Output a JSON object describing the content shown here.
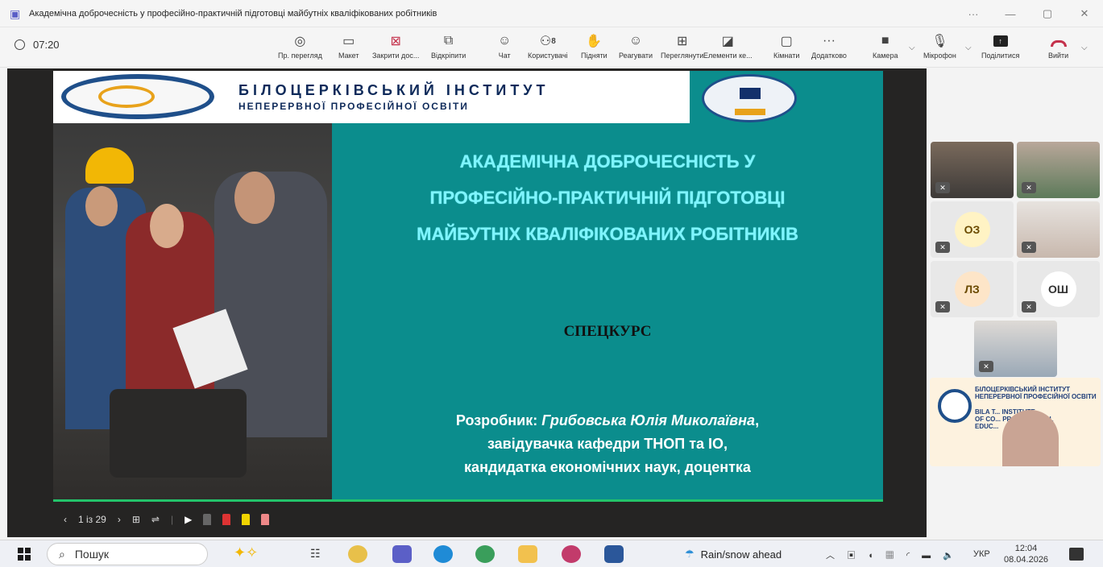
{
  "window": {
    "title": "Академічна доброчесність у професійно-практичній підготовці майбутніх кваліфікованих робітників",
    "controls": [
      "···",
      "—",
      "▢",
      "✕"
    ]
  },
  "meeting": {
    "elapsed": "07:20"
  },
  "toolbar": {
    "items": [
      {
        "label": "Пр. перегляд",
        "icon": "eye-icon"
      },
      {
        "label": "Макет",
        "icon": "layout-icon"
      },
      {
        "label": "Закрити дос...",
        "icon": "close-share-icon"
      },
      {
        "label": "Відкріпити",
        "icon": "unpin-icon"
      },
      {
        "label": "Чат",
        "icon": "chat-icon"
      },
      {
        "label": "Користувачі",
        "icon": "people-icon",
        "count": "8"
      },
      {
        "label": "Підняти",
        "icon": "raise-hand-icon"
      },
      {
        "label": "Реагувати",
        "icon": "react-icon"
      },
      {
        "label": "Переглянути",
        "icon": "view-icon"
      },
      {
        "label": "Елементи ке...",
        "icon": "apps-icon"
      },
      {
        "label": "Кімнати",
        "icon": "rooms-icon"
      },
      {
        "label": "Додатково",
        "icon": "more-icon"
      },
      {
        "label": "Камера",
        "icon": "camera-icon"
      },
      {
        "label": "Мікрофон",
        "icon": "mic-icon"
      },
      {
        "label": "Поділитися",
        "icon": "share-icon"
      },
      {
        "label": "Вийти",
        "icon": "leave-icon"
      }
    ]
  },
  "slide": {
    "institute_line1": "БІЛОЦЕРКІВСЬКИЙ ІНСТИТУТ",
    "institute_line2": "НЕПЕРЕРВНОЇ ПРОФЕСІЙНОЇ ОСВІТИ",
    "title_line1": "АКАДЕМІЧНА ДОБРОЧЕСНІСТЬ У",
    "title_line2": "ПРОФЕСІЙНО-ПРАКТИЧНІЙ ПІДГОТОВЦІ",
    "title_line3": "МАЙБУТНІХ КВАЛІФІКОВАНИХ РОБІТНИКІВ",
    "course": "СПЕЦКУРС",
    "author_prefix": "Розробник: ",
    "author_name": "Грибовська  Юлія Миколаївна",
    "author_suffix": ",",
    "author_line2": "завідувачка кафедри ТНОП та ІО,",
    "author_line3": "кандидатка економічних наук, доцентка"
  },
  "slide_controls": {
    "prev": "‹",
    "page": "1 із 29",
    "next": "›"
  },
  "participants": {
    "tiles": [
      {
        "initials": "",
        "kind": "video"
      },
      {
        "initials": "",
        "kind": "video"
      },
      {
        "initials": "ОЗ",
        "kind": "avatar"
      },
      {
        "initials": "",
        "kind": "video"
      },
      {
        "initials": "ЛЗ",
        "kind": "avatar"
      },
      {
        "initials": "ОШ",
        "kind": "avatar"
      },
      {
        "initials": "",
        "kind": "video"
      }
    ],
    "presenter_banner_line1": "БІЛОЦЕРКІВСЬКИЙ ІНСТИТУТ",
    "presenter_banner_line2": "НЕПЕРЕРВНОЇ ПРОФЕСІЙНОЇ ОСВІТИ",
    "presenter_banner_line3": "BILA T... INSTITUTE",
    "presenter_banner_line4": "OF CO... PROFESSIONAL",
    "presenter_banner_line5": "EDUC..."
  },
  "taskbar": {
    "search_placeholder": "Пошук",
    "weather": "Rain/snow ahead",
    "lang": "УКР",
    "time": "12:04",
    "date": "08.04.2026"
  }
}
